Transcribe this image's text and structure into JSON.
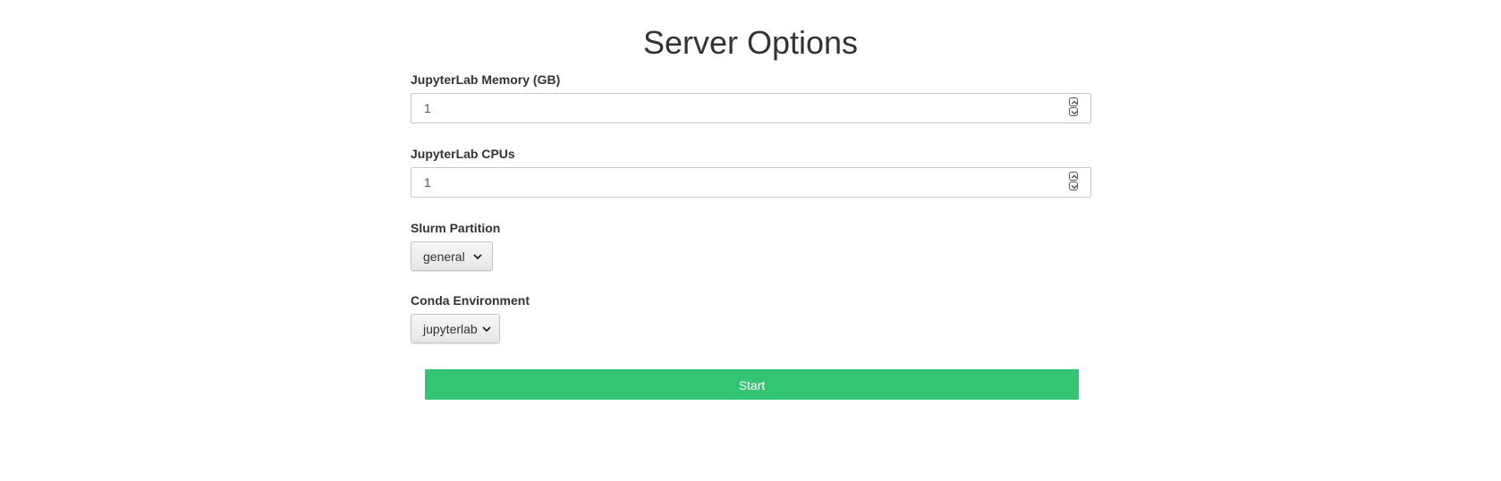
{
  "page": {
    "title": "Server Options"
  },
  "form": {
    "memory": {
      "label": "JupyterLab Memory (GB)",
      "value": "1"
    },
    "cpus": {
      "label": "JupyterLab CPUs",
      "value": "1"
    },
    "partition": {
      "label": "Slurm Partition",
      "selected": "general"
    },
    "conda_env": {
      "label": "Conda Environment",
      "selected": "jupyterlab"
    },
    "start_label": "Start"
  },
  "colors": {
    "start_button": "#33c474",
    "text": "#333333"
  },
  "icons": {
    "spinner_up": "chevron-up-icon",
    "spinner_down": "chevron-down-icon",
    "select_arrow": "chevron-down-icon"
  }
}
